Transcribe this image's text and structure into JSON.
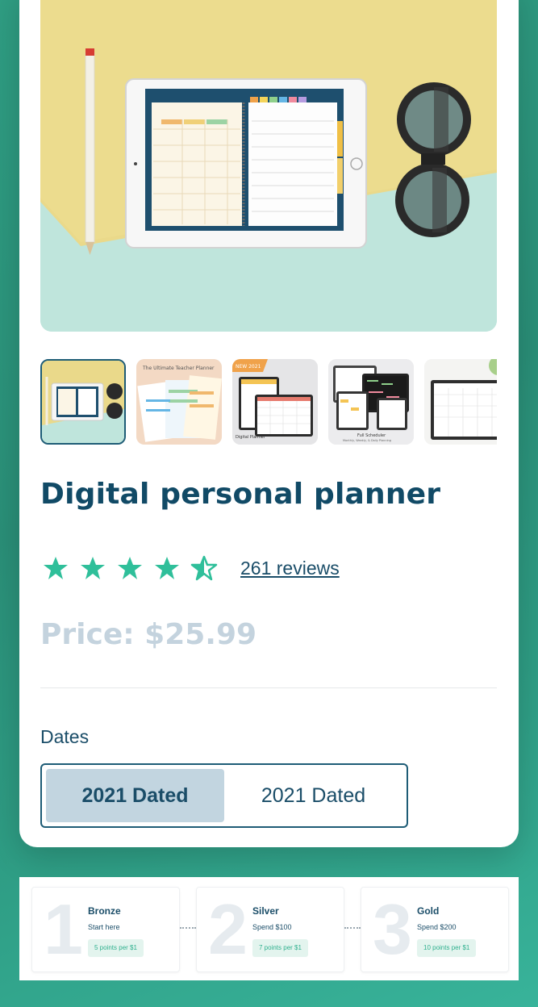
{
  "product": {
    "title": "Digital personal planner",
    "rating": 4.5,
    "reviews_label": "261 reviews",
    "price_label": "Price: $25.99"
  },
  "gallery": {
    "thumbnails": [
      {
        "name": "tablet-planner"
      },
      {
        "name": "teacher-planner",
        "caption": "The Ultimate Teacher Planner"
      },
      {
        "name": "new-2021",
        "tag": "NEW 2021",
        "caption": "Digital Planner"
      },
      {
        "name": "full-scheduler",
        "caption": "Full Scheduler",
        "subcaption": "Monthly, Weekly, & Daily Planning"
      },
      {
        "name": "monthly-sheet"
      }
    ]
  },
  "dates": {
    "label": "Dates",
    "options": [
      "2021 Dated",
      "2021 Dated"
    ],
    "selected_index": 0
  },
  "tiers": [
    {
      "number": "1",
      "name": "Bronze",
      "sub": "Start here",
      "badge": "5 points per $1"
    },
    {
      "number": "2",
      "name": "Silver",
      "sub": "Spend $100",
      "badge": "7 points per $1"
    },
    {
      "number": "3",
      "name": "Gold",
      "sub": "Spend $200",
      "badge": "10 points per $1"
    }
  ],
  "colors": {
    "accent": "#2fbf9a",
    "primary_text": "#114a66",
    "background": "#2f9e83"
  }
}
